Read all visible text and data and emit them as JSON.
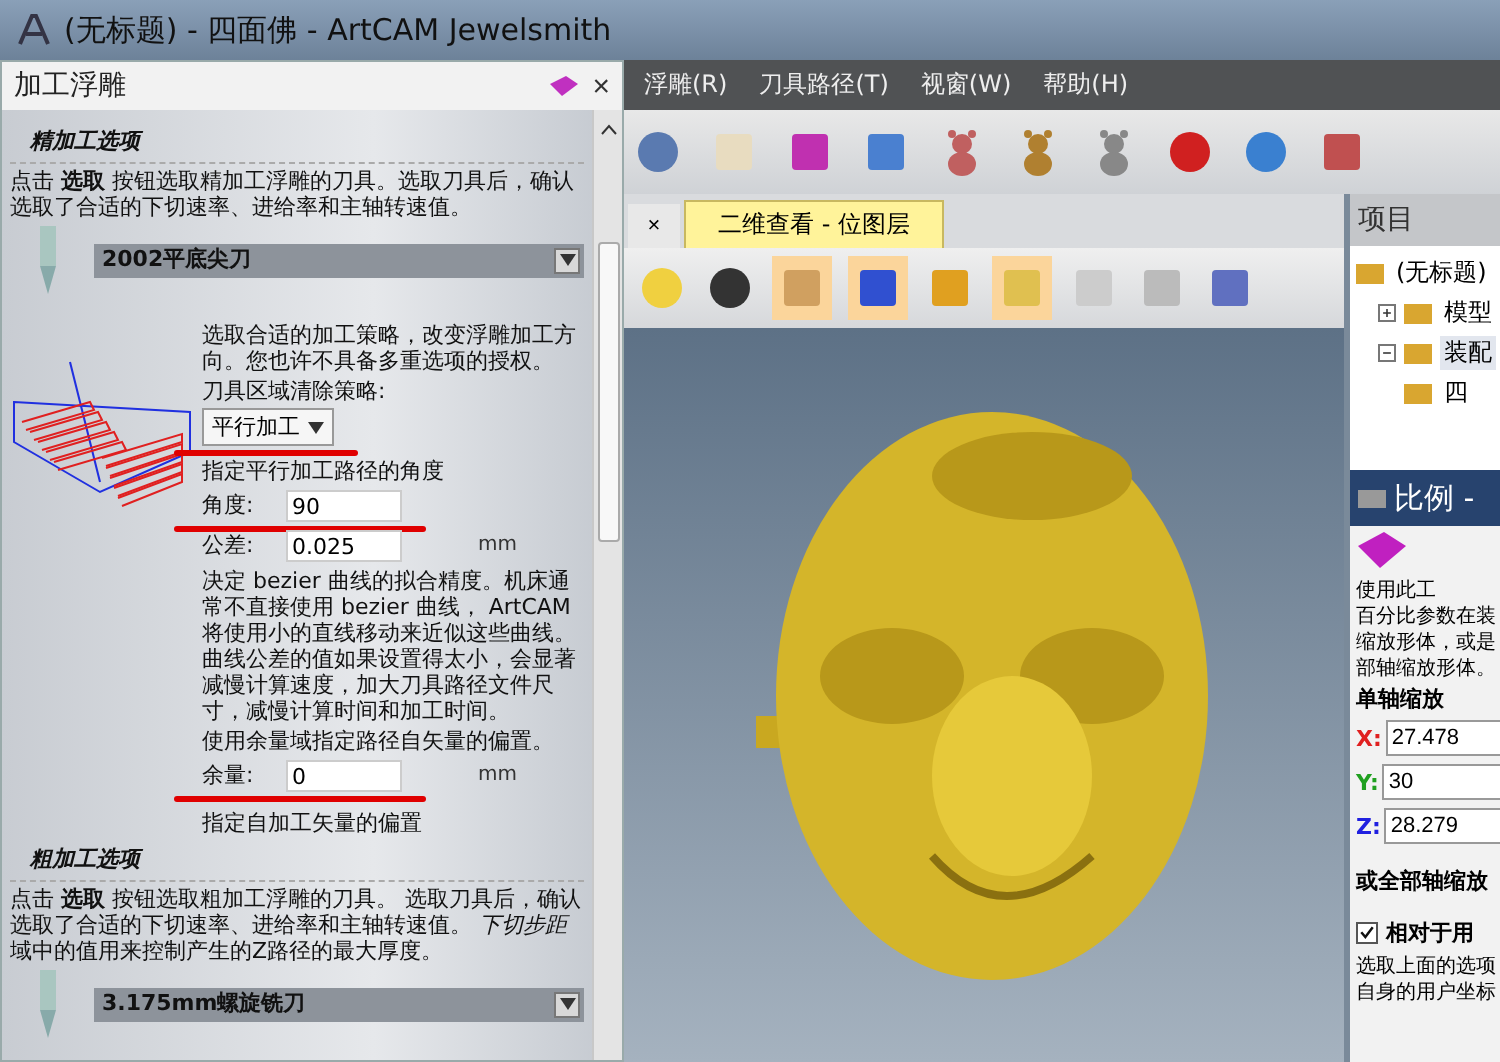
{
  "window": {
    "title": "(无标题) - 四面佛 - ArtCAM Jewelsmith"
  },
  "left_panel": {
    "title": "加工浮雕",
    "close": "×",
    "finishing": {
      "heading": "精加工选项",
      "intro": "点击 **选取** 按钮选取精加工浮雕的刀具。选取刀具后，确认选取了合适的下切速率、进给率和主轴转速值。",
      "tool": "2002平底尖刀",
      "strategy_note": "选取合适的加工策略，改变浮雕加工方向。您也许不具备多重选项的授权。",
      "strategy_label": "刀具区域清除策略:",
      "strategy": {
        "value": "平行加工",
        "marked": true
      },
      "angle_note": "指定平行加工路径的角度",
      "fields": [
        {
          "label": "角度:",
          "value": "90",
          "marked": true
        },
        {
          "label": "公差:",
          "value": "0.025",
          "unit": "mm"
        }
      ],
      "bezier_note": "决定 bezier 曲线的拟合精度。机床通常不直接使用 bezier 曲线， ArtCAM 将使用小的直线移动来近似这些曲线。曲线公差的值如果设置得太小，会显著减慢计算速度，加大刀具路径文件尺寸，减慢计算时间和加工时间。",
      "allowance_note": "使用余量域指定路径自矢量的偏置。",
      "allowance": {
        "label": "余量:",
        "value": "0",
        "unit": "mm",
        "marked": true
      },
      "allowance_after": "指定自加工矢量的偏置"
    },
    "roughing": {
      "heading": "粗加工选项",
      "intro": "点击 **选取** 按钮选取粗加工浮雕的刀具。 选取刀具后，确认选取了合适的下切速率、进给率和主轴转速值。 ",
      "emphasis": "下切步距",
      "intro_rest": "域中的值用来控制产生的Z路径的最大厚度。",
      "tool": "3.175mm螺旋铣刀"
    }
  },
  "menu": [
    "浮雕(R)",
    "刀具路径(T)",
    "视窗(W)",
    "帮助(H)"
  ],
  "document_tabs": {
    "close": "×",
    "tabs": [
      {
        "label": "二维查看 - 位图层",
        "selected": true
      }
    ]
  },
  "project_panel": {
    "title": "项目",
    "tree": [
      {
        "label": "(无标题)",
        "children": [
          {
            "label": "模型",
            "expanded": false,
            "selected": false
          },
          {
            "label": "装配",
            "expanded": true,
            "selected": true,
            "children": [
              {
                "label": "四"
              }
            ]
          }
        ]
      }
    ]
  },
  "scale_panel": {
    "title": "比例 -",
    "intro_lines": [
      "使用此工",
      "百分比参数在装",
      "缩放形体，或是",
      "部轴缩放形体。"
    ],
    "single_axis": "单轴缩放",
    "axes": [
      {
        "label": "X:",
        "value": "27.478",
        "color": "#e02020"
      },
      {
        "label": "Y:",
        "value": "30",
        "color": "#20a020"
      },
      {
        "label": "Z:",
        "value": "28.279",
        "color": "#2020e0"
      }
    ],
    "all_axes": "或全部轴缩放",
    "relative": {
      "label": "相对于用",
      "checked": true
    },
    "notes": [
      "选取上面的选项",
      "自身的用户坐标"
    ]
  }
}
